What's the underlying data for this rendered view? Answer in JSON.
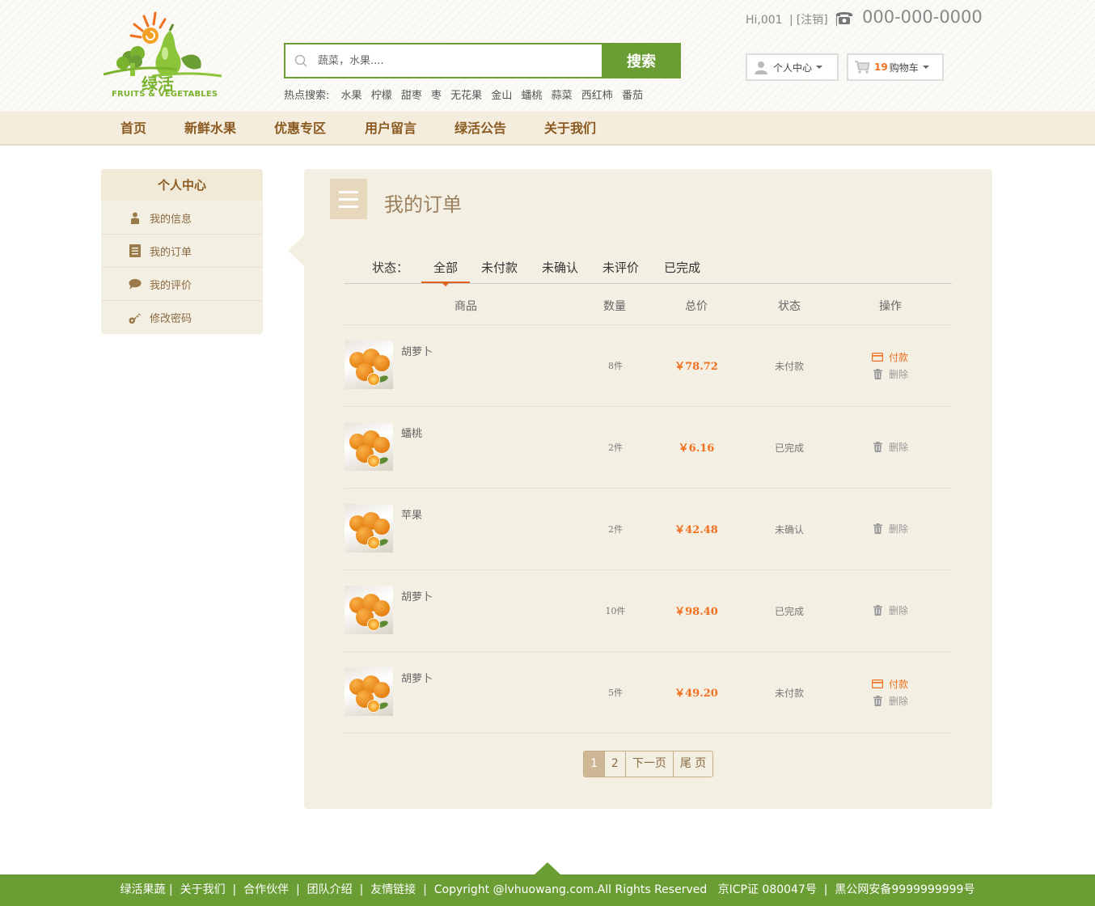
{
  "brand": {
    "name": "绿活",
    "subtitle": "FRUITS & VEGETABLES",
    "color": "#7ab32e"
  },
  "search": {
    "placeholder": "蔬菜，水果....",
    "button_label": "搜索",
    "hot_label": "热点搜索:",
    "hot_terms": [
      "水果",
      "柠檬",
      "甜枣",
      "枣",
      "无花果",
      "金山",
      "蟠桃",
      "蒜菜",
      "西红柿",
      "番茄"
    ]
  },
  "userbar": {
    "greeting": "Hi,001",
    "logout": "[注销]",
    "sep": "|",
    "phone": "000-000-0000",
    "user_center": "个人中心",
    "cart_count": "19",
    "cart_label": "购物车"
  },
  "nav": [
    "首页",
    "新鲜水果",
    "优惠专区",
    "用户留言",
    "绿活公告",
    "关于我们"
  ],
  "sidebar": {
    "title": "个人中心",
    "items": [
      {
        "label": "我的信息",
        "icon": "user-icon"
      },
      {
        "label": "我的订单",
        "icon": "list-icon"
      },
      {
        "label": "我的评价",
        "icon": "comment-icon"
      },
      {
        "label": "修改密码",
        "icon": "key-icon"
      }
    ]
  },
  "orders": {
    "title": "我的订单",
    "status_label": "状态：",
    "tabs": [
      "全部",
      "未付款",
      "未确认",
      "未评价",
      "已完成"
    ],
    "active_tab": "全部",
    "columns": [
      "商品",
      "数量",
      "总价",
      "状态",
      "操作"
    ],
    "pay_label": "付款",
    "delete_label": "删除",
    "rows": [
      {
        "name": "胡萝卜",
        "qty": "8件",
        "price": "￥78.72",
        "status": "未付款",
        "can_pay": true
      },
      {
        "name": "蟠桃",
        "qty": "2件",
        "price": "￥6.16",
        "status": "已完成",
        "can_pay": false
      },
      {
        "name": "苹果",
        "qty": "2件",
        "price": "￥42.48",
        "status": "未确认",
        "can_pay": false
      },
      {
        "name": "胡萝卜",
        "qty": "10件",
        "price": "￥98.40",
        "status": "已完成",
        "can_pay": false
      },
      {
        "name": "胡萝卜",
        "qty": "5件",
        "price": "￥49.20",
        "status": "未付款",
        "can_pay": true
      }
    ]
  },
  "pager": {
    "pages": [
      "1",
      "2"
    ],
    "current": "1",
    "next": "下一页",
    "last": "尾 页"
  },
  "footer": {
    "links": [
      "绿活果蔬",
      "关于我们",
      "合作伙伴",
      "团队介绍",
      "友情链接"
    ],
    "copyright": "Copyright @lvhuowang.com.All Rights Reserved",
    "icp": "京ICP证 080047号",
    "security": "黑公网安备9999999999号"
  },
  "colors": {
    "accent_green": "#6b9d35",
    "accent_orange": "#f07020",
    "panel_bg": "#f4efe3",
    "nav_text": "#8a5a20"
  }
}
